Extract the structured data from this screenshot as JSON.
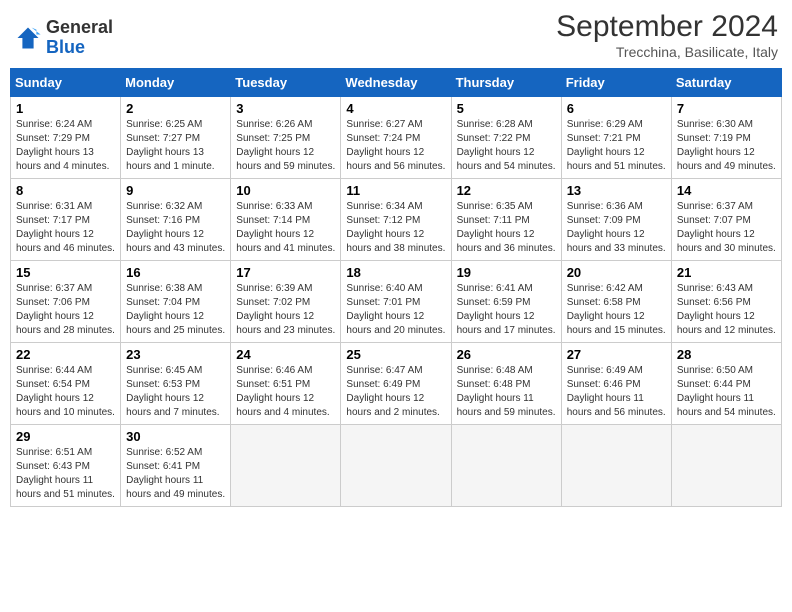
{
  "header": {
    "logo_general": "General",
    "logo_blue": "Blue",
    "month_year": "September 2024",
    "location": "Trecchina, Basilicate, Italy"
  },
  "columns": [
    "Sunday",
    "Monday",
    "Tuesday",
    "Wednesday",
    "Thursday",
    "Friday",
    "Saturday"
  ],
  "weeks": [
    [
      {
        "day": "1",
        "sunrise": "6:24 AM",
        "sunset": "7:29 PM",
        "daylight": "13 hours and 4 minutes."
      },
      {
        "day": "2",
        "sunrise": "6:25 AM",
        "sunset": "7:27 PM",
        "daylight": "13 hours and 1 minute."
      },
      {
        "day": "3",
        "sunrise": "6:26 AM",
        "sunset": "7:25 PM",
        "daylight": "12 hours and 59 minutes."
      },
      {
        "day": "4",
        "sunrise": "6:27 AM",
        "sunset": "7:24 PM",
        "daylight": "12 hours and 56 minutes."
      },
      {
        "day": "5",
        "sunrise": "6:28 AM",
        "sunset": "7:22 PM",
        "daylight": "12 hours and 54 minutes."
      },
      {
        "day": "6",
        "sunrise": "6:29 AM",
        "sunset": "7:21 PM",
        "daylight": "12 hours and 51 minutes."
      },
      {
        "day": "7",
        "sunrise": "6:30 AM",
        "sunset": "7:19 PM",
        "daylight": "12 hours and 49 minutes."
      }
    ],
    [
      {
        "day": "8",
        "sunrise": "6:31 AM",
        "sunset": "7:17 PM",
        "daylight": "12 hours and 46 minutes."
      },
      {
        "day": "9",
        "sunrise": "6:32 AM",
        "sunset": "7:16 PM",
        "daylight": "12 hours and 43 minutes."
      },
      {
        "day": "10",
        "sunrise": "6:33 AM",
        "sunset": "7:14 PM",
        "daylight": "12 hours and 41 minutes."
      },
      {
        "day": "11",
        "sunrise": "6:34 AM",
        "sunset": "7:12 PM",
        "daylight": "12 hours and 38 minutes."
      },
      {
        "day": "12",
        "sunrise": "6:35 AM",
        "sunset": "7:11 PM",
        "daylight": "12 hours and 36 minutes."
      },
      {
        "day": "13",
        "sunrise": "6:36 AM",
        "sunset": "7:09 PM",
        "daylight": "12 hours and 33 minutes."
      },
      {
        "day": "14",
        "sunrise": "6:37 AM",
        "sunset": "7:07 PM",
        "daylight": "12 hours and 30 minutes."
      }
    ],
    [
      {
        "day": "15",
        "sunrise": "6:37 AM",
        "sunset": "7:06 PM",
        "daylight": "12 hours and 28 minutes."
      },
      {
        "day": "16",
        "sunrise": "6:38 AM",
        "sunset": "7:04 PM",
        "daylight": "12 hours and 25 minutes."
      },
      {
        "day": "17",
        "sunrise": "6:39 AM",
        "sunset": "7:02 PM",
        "daylight": "12 hours and 23 minutes."
      },
      {
        "day": "18",
        "sunrise": "6:40 AM",
        "sunset": "7:01 PM",
        "daylight": "12 hours and 20 minutes."
      },
      {
        "day": "19",
        "sunrise": "6:41 AM",
        "sunset": "6:59 PM",
        "daylight": "12 hours and 17 minutes."
      },
      {
        "day": "20",
        "sunrise": "6:42 AM",
        "sunset": "6:58 PM",
        "daylight": "12 hours and 15 minutes."
      },
      {
        "day": "21",
        "sunrise": "6:43 AM",
        "sunset": "6:56 PM",
        "daylight": "12 hours and 12 minutes."
      }
    ],
    [
      {
        "day": "22",
        "sunrise": "6:44 AM",
        "sunset": "6:54 PM",
        "daylight": "12 hours and 10 minutes."
      },
      {
        "day": "23",
        "sunrise": "6:45 AM",
        "sunset": "6:53 PM",
        "daylight": "12 hours and 7 minutes."
      },
      {
        "day": "24",
        "sunrise": "6:46 AM",
        "sunset": "6:51 PM",
        "daylight": "12 hours and 4 minutes."
      },
      {
        "day": "25",
        "sunrise": "6:47 AM",
        "sunset": "6:49 PM",
        "daylight": "12 hours and 2 minutes."
      },
      {
        "day": "26",
        "sunrise": "6:48 AM",
        "sunset": "6:48 PM",
        "daylight": "11 hours and 59 minutes."
      },
      {
        "day": "27",
        "sunrise": "6:49 AM",
        "sunset": "6:46 PM",
        "daylight": "11 hours and 56 minutes."
      },
      {
        "day": "28",
        "sunrise": "6:50 AM",
        "sunset": "6:44 PM",
        "daylight": "11 hours and 54 minutes."
      }
    ],
    [
      {
        "day": "29",
        "sunrise": "6:51 AM",
        "sunset": "6:43 PM",
        "daylight": "11 hours and 51 minutes."
      },
      {
        "day": "30",
        "sunrise": "6:52 AM",
        "sunset": "6:41 PM",
        "daylight": "11 hours and 49 minutes."
      },
      null,
      null,
      null,
      null,
      null
    ]
  ]
}
